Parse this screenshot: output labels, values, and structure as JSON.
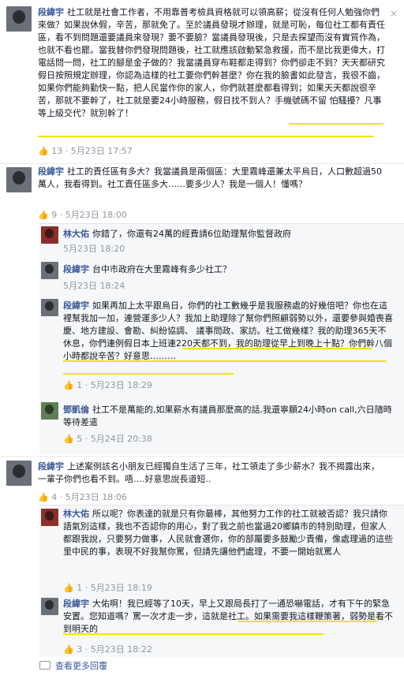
{
  "comments": [
    {
      "author": "段緯宇",
      "text": "社工就是社會工作者，不用靠普考檢具資格就可以領高薪；從沒有任何人勉強你們來做？如果說休假，辛苦，那就免了。至於議員發現才辦理，就是可恥，每位社工都有責任區，看不到問題還要議員來發現？要不要臉？當議員發現後，只是去探望而沒有實質作為，也就不看也罷。當我替你們發現問題後，社工就應該啟動緊急救援，而不是比我更偉大，打電話問一問，社工的腳是金子做的？我當議員穿布鞋都走得到？你們卻走不到？天天都研究假日按照規定辦理，你認為這樣的社工要你們幹甚麼？你在我的臉書如此發言，我很不齒，如果你們能夠勤快一點，把人民當作你的家人，你們就甚麼都看得到；如果天天都說很辛苦，那就不要幹了，社工就是要24小時服務，假日找不到人？手機號碼不留 怕騷擾？凡事等上級交代？就別幹了！",
      "likes": "13",
      "time": "5月23日 17:57"
    },
    {
      "author": "段緯宇",
      "text": "社工的責任區有多大？我當議員是兩個區：大里霧峰還兼太平烏日，人口數超過50萬人，我看得到。社工責任區多大……要多少人？我是一個人！懂嗎？",
      "likes": "9",
      "time": "5月23日 18:00"
    }
  ],
  "replies1": [
    {
      "author": "林大佑",
      "text": "你錯了，你還有24萬的經費請6位助理幫你監督政府",
      "time": "5月23日 18:20"
    },
    {
      "author": "段緯宇",
      "text": "台中市政府在大里霧峰有多少社工？",
      "time": "5月23日 18:24"
    },
    {
      "author": "段緯宇",
      "text": "如果再加上太平跟烏日，你們的社工數幾乎是我服務處的好幾倍吧？你也在這裡幫我加一加，連營運多少人？我加上助理除了幫你們照顧弱勢以外，還要參與婚喪喜慶、地方建設、會勘、糾紛協調、 議事問政、家訪。社工做幾樣？我的助理365天不休息，你們連例假日本上班連220天都不到，我的助理從早上到晚上十點？你們幹八個小時都說辛苦？好意思………",
      "likes": "1",
      "time": "5月23日 18:29"
    },
    {
      "author": "鄧凱倫",
      "text": "社工不是萬能的,如果薪水有議員那麼高的話,我還寧願24小時on call,六日隨時等待差遣",
      "likes": "5",
      "time": "5月24日 20:38"
    }
  ],
  "comment3": {
    "author": "段緯宇",
    "text": "上述案例該名小朋友已經獨自生活了三年，社工領走了多少薪水？我不揭露出來，一輩子你們也看不到。唔….好意思說長道短..",
    "likes": "4",
    "time": "5月23日 18:06"
  },
  "replies2": [
    {
      "author": "林大佑",
      "text": "所以呢？你表達的就是只有你最棒，其他努力工作的社工就被否認？我只請你語氣別這樣，我也不否認你的用心，對了我之前也當過20鄉鎮市的特別助理，但家人都跟我說，只要努力做事，人民就會選你，你的部屬要多鼓勵少責備，像處理過的這些里中民的事，表現不好我幫你罵，但請先讓他們處理，不要一開始就罵人",
      "likes": "1",
      "time": "5月23日 18:19"
    },
    {
      "author": "段緯宇",
      "text": "大佑啊！我已經等了10天，早上又跟局長打了一通恐嚇電話，才有下午的緊急安置。您知道嗎？罵一次才走一步，這就是社工。如果需要我這樣鞭策著，弱勢是看不到明天的",
      "likes": "3",
      "time": "5月23日 18:22"
    }
  ],
  "ui": {
    "like_sep": "·",
    "more_replies": "查看更多回覆",
    "close": "×"
  },
  "colors": {
    "link": "#3b5998",
    "meta": "#9197a3",
    "highlight": "#f3e600",
    "reply_bg": "#f6f7f8"
  }
}
